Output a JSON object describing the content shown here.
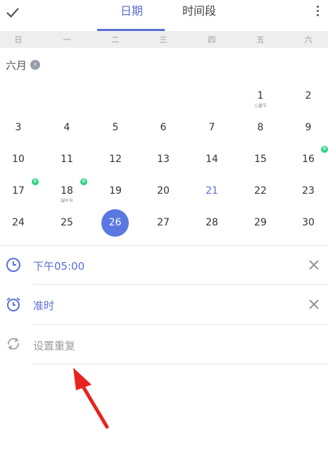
{
  "header": {
    "tab_date": "日期",
    "tab_period": "时间段"
  },
  "weekdays": [
    "日",
    "一",
    "二",
    "三",
    "四",
    "五",
    "六"
  ],
  "calendar": {
    "month_label": "六月",
    "month_arrow": "‹",
    "selected_day": "26",
    "days": [
      [
        "1",
        "2",
        "3",
        "4",
        "5",
        "6",
        "7",
        "8",
        "9",
        "10",
        "11",
        "12",
        "13",
        "14",
        "15",
        "16",
        "17",
        "18",
        "19",
        "20",
        "21",
        "22",
        "23",
        "24",
        "25",
        "26",
        "27",
        "28",
        "29",
        "30"
      ]
    ],
    "holiday_children": "儿童节",
    "holiday_dragon": "端午节",
    "badge_text": "休"
  },
  "settings": {
    "time_value": "下午05:00",
    "reminder_value": "准时",
    "repeat_placeholder": "设置重复"
  },
  "colors": {
    "accent": "#5a6fd6",
    "selected": "#5a78e0",
    "badge": "#2fcf86",
    "arrow": "#e8231f"
  }
}
